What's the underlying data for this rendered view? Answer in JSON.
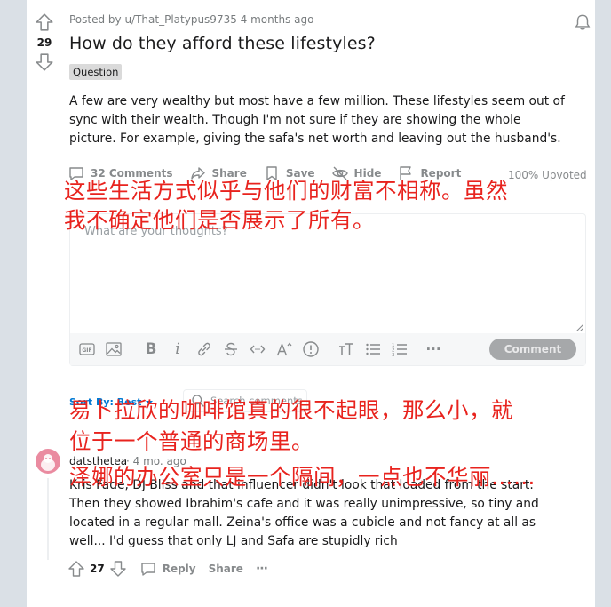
{
  "post": {
    "score": "29",
    "meta": "Posted by u/That_Platypus9735 4 months ago",
    "title": "How do they afford these lifestyles?",
    "flair": "Question",
    "body": "A few are very wealthy but most have a few million. These lifestyles seem out of sync with their wealth. Though I'm not sure if they are showing the whole picture. For example, giving the safa's net worth and leaving out the husband's.",
    "actions": {
      "comments": "32 Comments",
      "share": "Share",
      "save": "Save",
      "hide": "Hide",
      "report": "Report"
    },
    "upvoted": "100% Upvoted"
  },
  "overlay": {
    "line1": "这些生活方式似乎与他们的财富不相称。虽然",
    "line2": "我不确定他们是否展示了所有。",
    "line3": "易卜拉欣的咖啡馆真的很不起眼，那么小，就",
    "line4": "位于一个普通的商场里。",
    "line5": "泽娜的办公室只是一个隔间，一点也不华丽……"
  },
  "editor": {
    "placeholder": "What are your thoughts?",
    "comment_button": "Comment"
  },
  "sort": {
    "label": "Sort By: Best",
    "search_placeholder": "Search comments"
  },
  "comment": {
    "author": "datsthetea",
    "time": "· 4 mo. ago",
    "body": "Kris Fade, DJ Bliss and that influencer didn't look that loaded from the start. Then they showed Ibrahim's cafe and it was really unimpressive, so tiny and located in a regular mall. Zeina's office was a cubicle and not fancy at all as well... I'd guess that only LJ and Safa are stupidly rich",
    "score": "27",
    "reply": "Reply",
    "share": "Share",
    "more": "···"
  },
  "colors": {
    "overlay": "#e8231e",
    "link": "#0079d3",
    "page_bg": "#dae0e6"
  }
}
